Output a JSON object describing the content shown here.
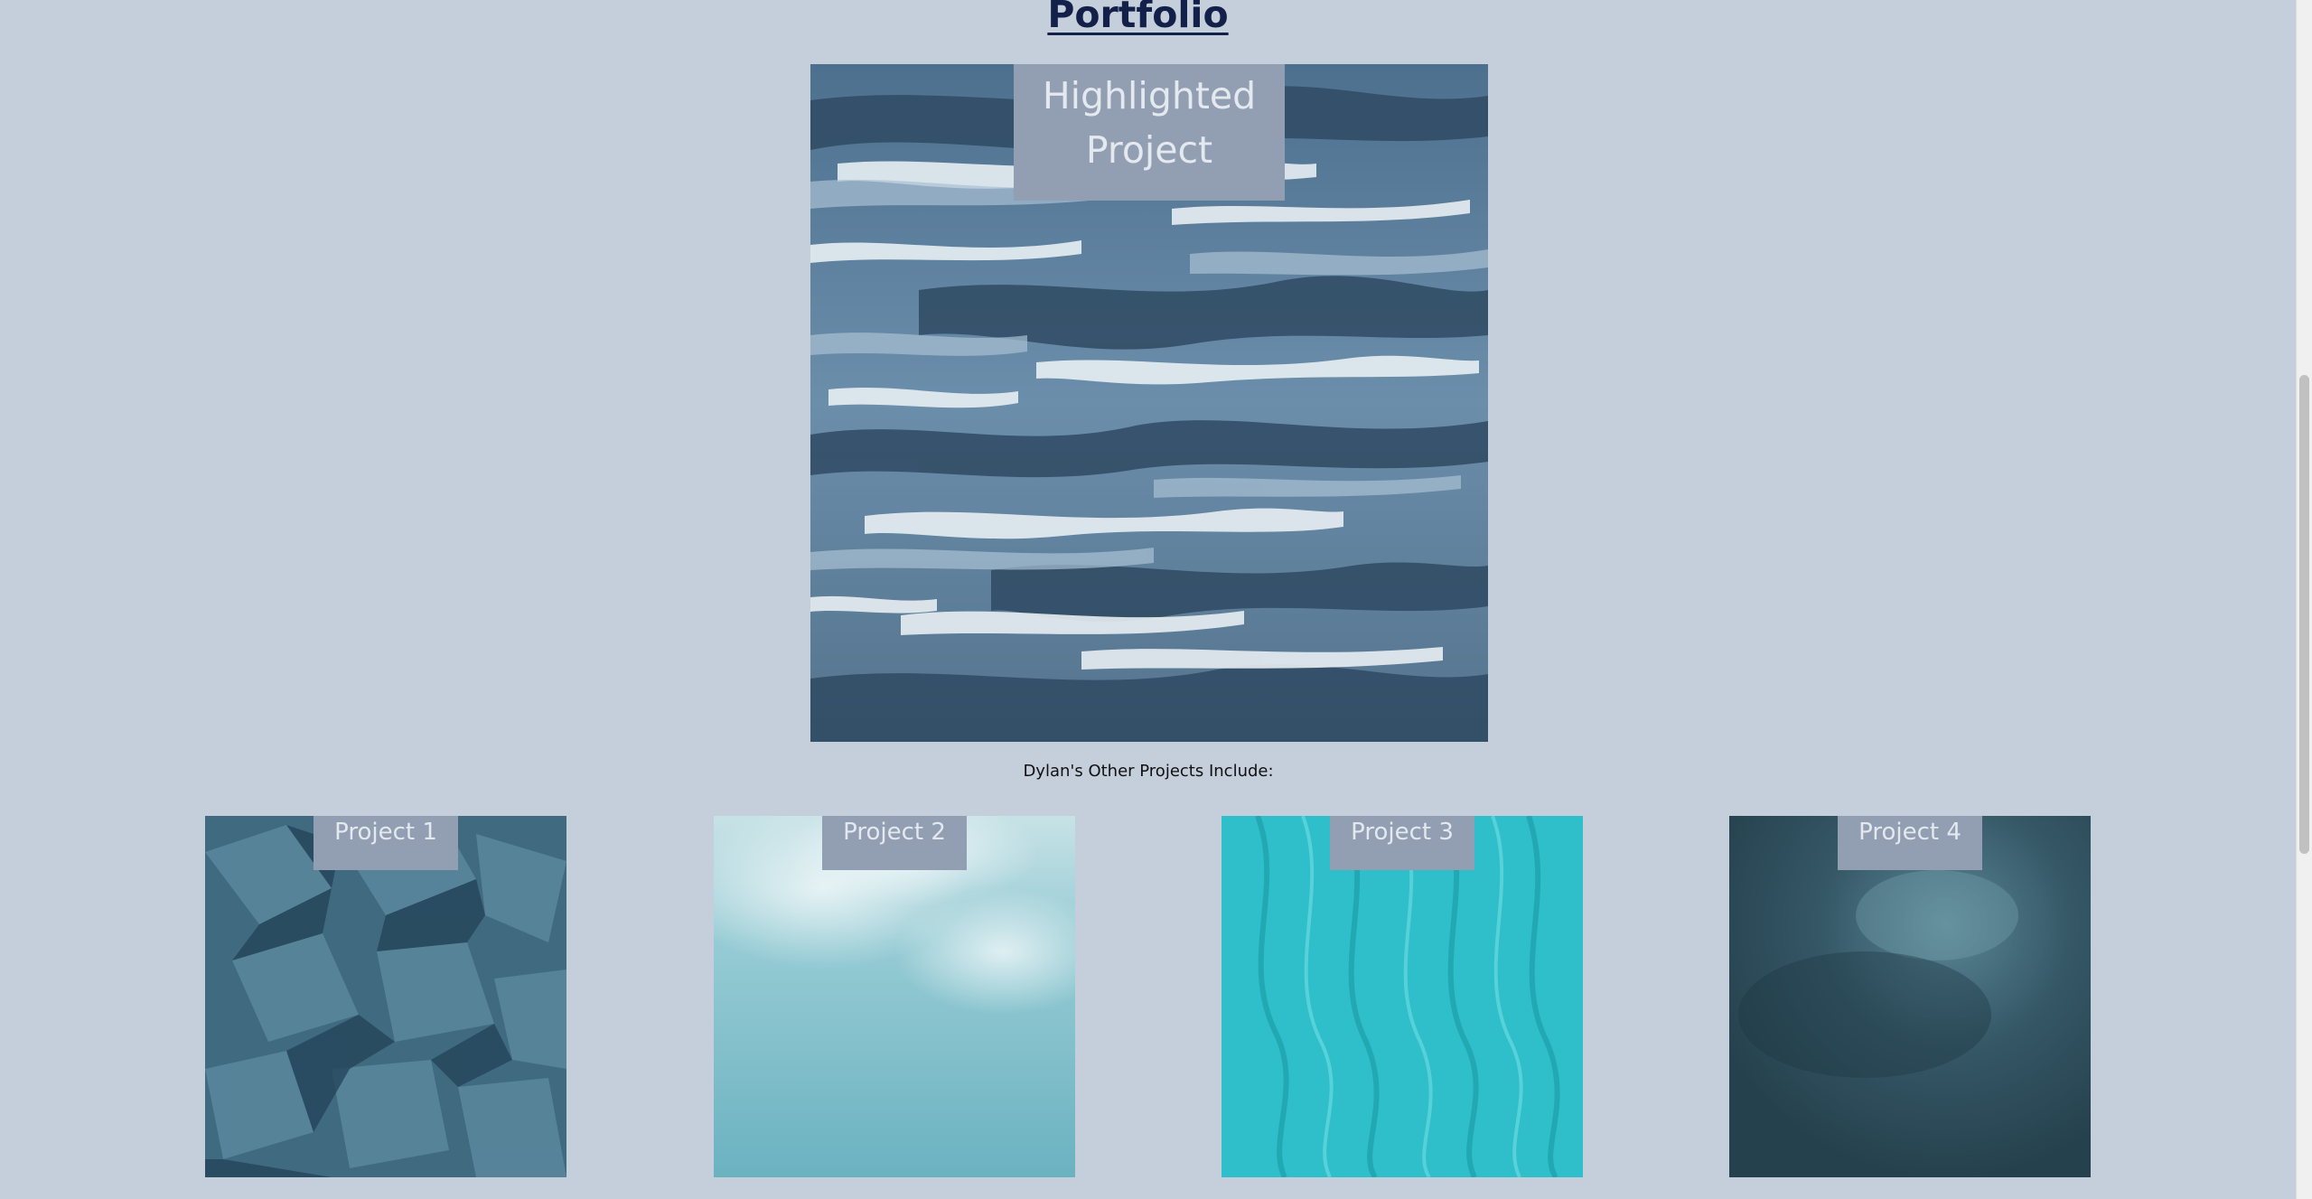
{
  "page": {
    "title": "Portfolio",
    "subheading": "Dylan's Other Projects Include:"
  },
  "highlight": {
    "label": "Highlighted Project",
    "image": "abstract-blue-white-paint-strokes"
  },
  "projects": [
    {
      "label": "Project 1",
      "image": "crumpled-teal-paper",
      "color": "#3f6a80"
    },
    {
      "label": "Project 2",
      "image": "light-aqua-sky",
      "color": "#7bbac7"
    },
    {
      "label": "Project 3",
      "image": "turquoise-water-texture",
      "color": "#2ebfca"
    },
    {
      "label": "Project 4",
      "image": "dark-teal-clouds",
      "color": "#2f4f5e"
    }
  ],
  "colors": {
    "background": "#c5cedb",
    "title": "#12204a",
    "label_box": "#929fb2",
    "label_text": "#e4e8ef"
  }
}
